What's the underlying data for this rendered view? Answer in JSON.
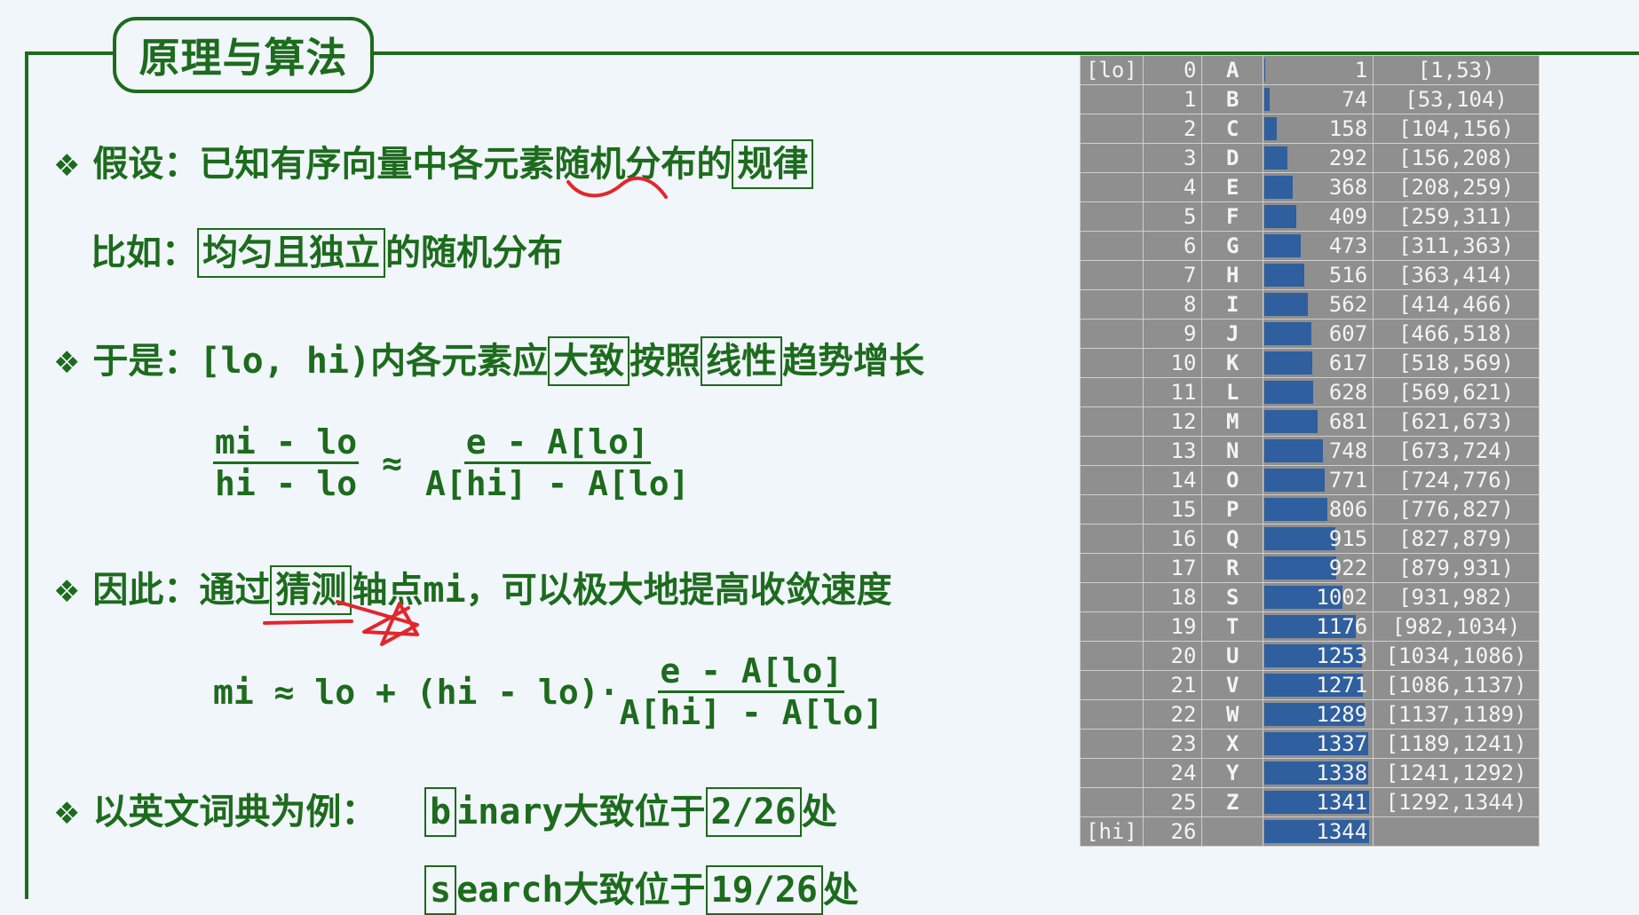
{
  "title": "原理与算法",
  "bullet": "❖",
  "l1": {
    "a": "假设：已知有序向量中各元素",
    "b": "随机",
    "c": "分布的",
    "box": "规律"
  },
  "l2": {
    "a": "比如：",
    "box": "均匀且独立",
    "c": "的随机分布"
  },
  "l3": {
    "a": "于是：",
    "code": "[lo, hi)",
    "b": "内各元素应",
    "box1": "大致",
    "c": "按照",
    "box2": "线性",
    "d": "趋势增长"
  },
  "f1": {
    "lnum": "mi - lo",
    "lden": "hi - lo",
    "approx": "≈",
    "rnum": "e - A[lo]",
    "rden": "A[hi] - A[lo]"
  },
  "l4": {
    "a": "因此：通过",
    "box": "猜测",
    "b": "轴点",
    "code": "mi",
    "c": "，可以极大地提高收敛速度"
  },
  "f2": {
    "lhs": "mi ≈ lo + (hi - lo)·",
    "num": "e - A[lo]",
    "den": "A[hi] - A[lo]"
  },
  "l5": {
    "a": "以英文词典为例：",
    "box1": "b",
    "b": "inary",
    "c": "大致位于",
    "box2": "2/26",
    "d": "处"
  },
  "l6": {
    "box1": "s",
    "b": "earch",
    "c": "大致位于",
    "box2": "19/26",
    "d": "处"
  },
  "table": {
    "colors": {
      "bg": "#8f8f8f",
      "bar": "#2f5f9e"
    },
    "max": 1344,
    "rows": [
      {
        "tag": "[lo]",
        "i": "0",
        "letter": "A",
        "value": 1,
        "range": "[1,53)"
      },
      {
        "tag": "",
        "i": "1",
        "letter": "B",
        "value": 74,
        "range": "[53,104)"
      },
      {
        "tag": "",
        "i": "2",
        "letter": "C",
        "value": 158,
        "range": "[104,156)"
      },
      {
        "tag": "",
        "i": "3",
        "letter": "D",
        "value": 292,
        "range": "[156,208)"
      },
      {
        "tag": "",
        "i": "4",
        "letter": "E",
        "value": 368,
        "range": "[208,259)"
      },
      {
        "tag": "",
        "i": "5",
        "letter": "F",
        "value": 409,
        "range": "[259,311)"
      },
      {
        "tag": "",
        "i": "6",
        "letter": "G",
        "value": 473,
        "range": "[311,363)"
      },
      {
        "tag": "",
        "i": "7",
        "letter": "H",
        "value": 516,
        "range": "[363,414)"
      },
      {
        "tag": "",
        "i": "8",
        "letter": "I",
        "value": 562,
        "range": "[414,466)"
      },
      {
        "tag": "",
        "i": "9",
        "letter": "J",
        "value": 607,
        "range": "[466,518)"
      },
      {
        "tag": "",
        "i": "10",
        "letter": "K",
        "value": 617,
        "range": "[518,569)"
      },
      {
        "tag": "",
        "i": "11",
        "letter": "L",
        "value": 628,
        "range": "[569,621)"
      },
      {
        "tag": "",
        "i": "12",
        "letter": "M",
        "value": 681,
        "range": "[621,673)"
      },
      {
        "tag": "",
        "i": "13",
        "letter": "N",
        "value": 748,
        "range": "[673,724)"
      },
      {
        "tag": "",
        "i": "14",
        "letter": "O",
        "value": 771,
        "range": "[724,776)"
      },
      {
        "tag": "",
        "i": "15",
        "letter": "P",
        "value": 806,
        "range": "[776,827)"
      },
      {
        "tag": "",
        "i": "16",
        "letter": "Q",
        "value": 915,
        "range": "[827,879)"
      },
      {
        "tag": "",
        "i": "17",
        "letter": "R",
        "value": 922,
        "range": "[879,931)"
      },
      {
        "tag": "",
        "i": "18",
        "letter": "S",
        "value": 1002,
        "range": "[931,982)"
      },
      {
        "tag": "",
        "i": "19",
        "letter": "T",
        "value": 1176,
        "range": "[982,1034)"
      },
      {
        "tag": "",
        "i": "20",
        "letter": "U",
        "value": 1253,
        "range": "[1034,1086)"
      },
      {
        "tag": "",
        "i": "21",
        "letter": "V",
        "value": 1271,
        "range": "[1086,1137)"
      },
      {
        "tag": "",
        "i": "22",
        "letter": "W",
        "value": 1289,
        "range": "[1137,1189)"
      },
      {
        "tag": "",
        "i": "23",
        "letter": "X",
        "value": 1337,
        "range": "[1189,1241)"
      },
      {
        "tag": "",
        "i": "24",
        "letter": "Y",
        "value": 1338,
        "range": "[1241,1292)"
      },
      {
        "tag": "",
        "i": "25",
        "letter": "Z",
        "value": 1341,
        "range": "[1292,1344)"
      },
      {
        "tag": "[hi]",
        "i": "26",
        "letter": "",
        "value": 1344,
        "range": ""
      }
    ]
  }
}
